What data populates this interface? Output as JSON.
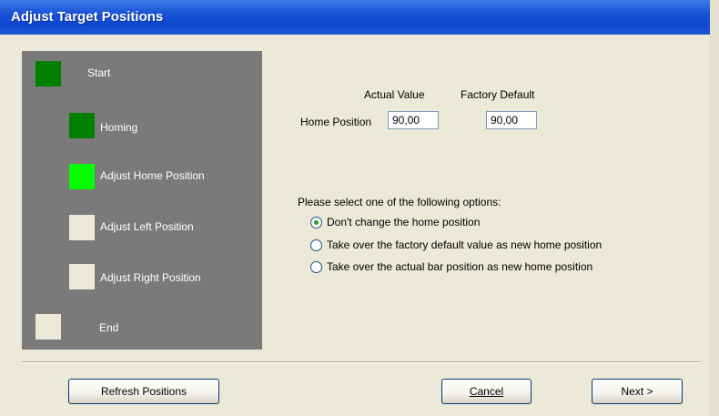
{
  "window": {
    "title": "Adjust Target Positions"
  },
  "steps": [
    {
      "label": "Start",
      "color": "#007f00"
    },
    {
      "label": "Homing",
      "color": "#007f00"
    },
    {
      "label": "Adjust Home Position",
      "color": "#00ff00"
    },
    {
      "label": "Adjust Left Position",
      "color": "#ece9d8"
    },
    {
      "label": "Adjust Right Position",
      "color": "#ece9d8"
    },
    {
      "label": "End",
      "color": "#ece9d8"
    }
  ],
  "form": {
    "actual_value_header": "Actual Value",
    "factory_default_header": "Factory Default",
    "home_position_label": "Home Position",
    "actual_value": "90,00",
    "factory_default_value": "90,00"
  },
  "options": {
    "prompt": "Please select one of the following options:",
    "items": [
      {
        "label": "Don't change the home position",
        "selected": true
      },
      {
        "label": "Take over the factory default value as new home position",
        "selected": false
      },
      {
        "label": "Take over the actual bar position as new home position",
        "selected": false
      }
    ]
  },
  "buttons": {
    "refresh": "Refresh Positions",
    "cancel": "Cancel",
    "next": "Next >"
  },
  "colors": {
    "titlebar": "#1c57d8",
    "panel": "#7a7a7a",
    "dialog_bg": "#ece9d8",
    "radio_dot": "#21a121"
  }
}
